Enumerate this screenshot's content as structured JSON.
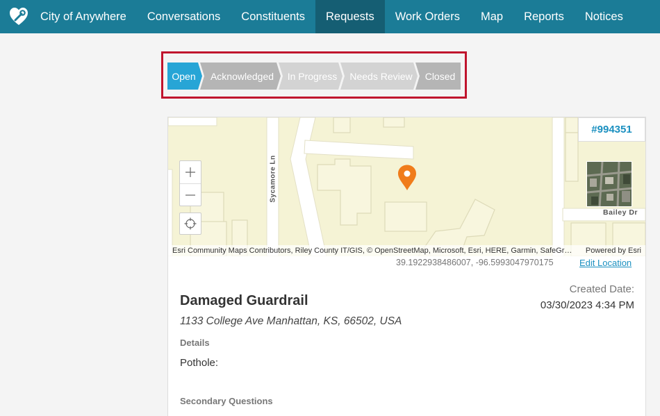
{
  "nav": {
    "brand": "City of Anywhere",
    "items": [
      "Conversations",
      "Constituents",
      "Requests",
      "Work Orders",
      "Map",
      "Reports",
      "Notices"
    ],
    "active": "Requests"
  },
  "stepper": {
    "steps": [
      "Open",
      "Acknowledged",
      "In Progress",
      "Needs Review",
      "Closed"
    ],
    "current": "Open"
  },
  "request": {
    "id": "#994351",
    "title": "Damaged Guardrail",
    "address": "1133 College Ave Manhattan, KS, 66502, USA",
    "created_label": "Created Date:",
    "created_value": "03/30/2023 4:34 PM",
    "details_label": "Details",
    "details_value": "Pothole:",
    "secondary_label": "Secondary Questions"
  },
  "map": {
    "street_labels": [
      "Sycamore Ln",
      "Bailey Dr"
    ],
    "attribution": "Esri Community Maps Contributors, Riley County IT/GIS, © OpenStreetMap, Microsoft, Esri, HERE, Garmin, SafeGraph, METI/NASA, USGS, EPA, NPS, USDA",
    "powered_by": "Powered by Esri",
    "coordinates": "39.1922938486007, -96.5993047970175",
    "edit_location": "Edit Location",
    "zoom_in": "+",
    "zoom_out": "—",
    "pin_color": "#f07c1b"
  },
  "colors": {
    "nav_bg": "#1b7c97",
    "nav_active": "#155e73",
    "step_active": "#27a5d6",
    "highlight_border": "#c0142d"
  }
}
